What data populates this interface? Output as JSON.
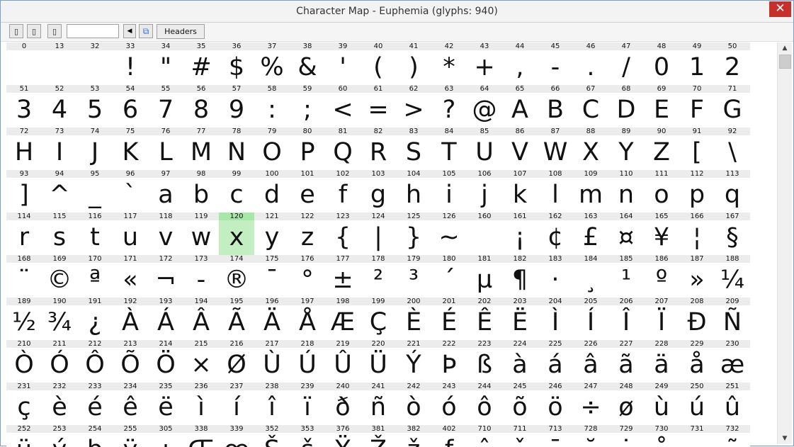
{
  "window": {
    "title": "Character Map - Euphemia   (glyphs: 940)",
    "close_label": "✕"
  },
  "toolbar": {
    "btn1": "▯",
    "btn2": "▯",
    "btn3": "▯",
    "search_value": "",
    "arrow_label": "◀",
    "copy_label": "⧉",
    "headers_label": "Headers"
  },
  "selected_code": "120",
  "glyph_rows": [
    [
      [
        "0",
        ""
      ],
      [
        "13",
        ""
      ],
      [
        "32",
        ""
      ],
      [
        "33",
        "!"
      ],
      [
        "34",
        "\""
      ],
      [
        "35",
        "#"
      ],
      [
        "36",
        "$"
      ],
      [
        "37",
        "%"
      ],
      [
        "38",
        "&"
      ],
      [
        "39",
        "'"
      ],
      [
        "40",
        "("
      ],
      [
        "41",
        ")"
      ],
      [
        "42",
        "*"
      ],
      [
        "43",
        "+"
      ],
      [
        "44",
        ","
      ],
      [
        "45",
        "-"
      ],
      [
        "46",
        "."
      ],
      [
        "47",
        "/"
      ],
      [
        "48",
        "0"
      ],
      [
        "49",
        "1"
      ],
      [
        "50",
        "2"
      ]
    ],
    [
      [
        "51",
        "3"
      ],
      [
        "52",
        "4"
      ],
      [
        "53",
        "5"
      ],
      [
        "54",
        "6"
      ],
      [
        "55",
        "7"
      ],
      [
        "56",
        "8"
      ],
      [
        "57",
        "9"
      ],
      [
        "58",
        ":"
      ],
      [
        "59",
        ";"
      ],
      [
        "60",
        "<"
      ],
      [
        "61",
        "="
      ],
      [
        "62",
        ">"
      ],
      [
        "63",
        "?"
      ],
      [
        "64",
        "@"
      ],
      [
        "65",
        "A"
      ],
      [
        "66",
        "B"
      ],
      [
        "67",
        "C"
      ],
      [
        "68",
        "D"
      ],
      [
        "69",
        "E"
      ],
      [
        "70",
        "F"
      ],
      [
        "71",
        "G"
      ]
    ],
    [
      [
        "72",
        "H"
      ],
      [
        "73",
        "I"
      ],
      [
        "74",
        "J"
      ],
      [
        "75",
        "K"
      ],
      [
        "76",
        "L"
      ],
      [
        "77",
        "M"
      ],
      [
        "78",
        "N"
      ],
      [
        "79",
        "O"
      ],
      [
        "80",
        "P"
      ],
      [
        "81",
        "Q"
      ],
      [
        "82",
        "R"
      ],
      [
        "83",
        "S"
      ],
      [
        "84",
        "T"
      ],
      [
        "85",
        "U"
      ],
      [
        "86",
        "V"
      ],
      [
        "87",
        "W"
      ],
      [
        "88",
        "X"
      ],
      [
        "89",
        "Y"
      ],
      [
        "90",
        "Z"
      ],
      [
        "91",
        "["
      ],
      [
        "92",
        "\\"
      ]
    ],
    [
      [
        "93",
        "]"
      ],
      [
        "94",
        "^"
      ],
      [
        "95",
        "_"
      ],
      [
        "96",
        "`"
      ],
      [
        "97",
        "a"
      ],
      [
        "98",
        "b"
      ],
      [
        "99",
        "c"
      ],
      [
        "100",
        "d"
      ],
      [
        "101",
        "e"
      ],
      [
        "102",
        "f"
      ],
      [
        "103",
        "g"
      ],
      [
        "104",
        "h"
      ],
      [
        "105",
        "i"
      ],
      [
        "106",
        "j"
      ],
      [
        "107",
        "k"
      ],
      [
        "108",
        "l"
      ],
      [
        "109",
        "m"
      ],
      [
        "110",
        "n"
      ],
      [
        "111",
        "o"
      ],
      [
        "112",
        "p"
      ],
      [
        "113",
        "q"
      ]
    ],
    [
      [
        "114",
        "r"
      ],
      [
        "115",
        "s"
      ],
      [
        "116",
        "t"
      ],
      [
        "117",
        "u"
      ],
      [
        "118",
        "v"
      ],
      [
        "119",
        "w"
      ],
      [
        "120",
        "x"
      ],
      [
        "121",
        "y"
      ],
      [
        "122",
        "z"
      ],
      [
        "123",
        "{"
      ],
      [
        "124",
        "|"
      ],
      [
        "125",
        "}"
      ],
      [
        "126",
        "~"
      ],
      [
        "160",
        ""
      ],
      [
        "161",
        "¡"
      ],
      [
        "162",
        "¢"
      ],
      [
        "163",
        "£"
      ],
      [
        "164",
        "¤"
      ],
      [
        "165",
        "¥"
      ],
      [
        "166",
        "¦"
      ],
      [
        "167",
        "§"
      ]
    ],
    [
      [
        "168",
        "¨"
      ],
      [
        "169",
        "©"
      ],
      [
        "170",
        "ª"
      ],
      [
        "171",
        "«"
      ],
      [
        "172",
        "¬"
      ],
      [
        "173",
        "-"
      ],
      [
        "174",
        "®"
      ],
      [
        "175",
        "¯"
      ],
      [
        "176",
        "°"
      ],
      [
        "177",
        "±"
      ],
      [
        "178",
        "²"
      ],
      [
        "179",
        "³"
      ],
      [
        "180",
        "´"
      ],
      [
        "181",
        "µ"
      ],
      [
        "182",
        "¶"
      ],
      [
        "183",
        "·"
      ],
      [
        "184",
        "¸"
      ],
      [
        "185",
        "¹"
      ],
      [
        "186",
        "º"
      ],
      [
        "187",
        "»"
      ],
      [
        "188",
        "¼"
      ]
    ],
    [
      [
        "189",
        "½"
      ],
      [
        "190",
        "¾"
      ],
      [
        "191",
        "¿"
      ],
      [
        "192",
        "À"
      ],
      [
        "193",
        "Á"
      ],
      [
        "194",
        "Â"
      ],
      [
        "195",
        "Ã"
      ],
      [
        "196",
        "Ä"
      ],
      [
        "197",
        "Å"
      ],
      [
        "198",
        "Æ"
      ],
      [
        "199",
        "Ç"
      ],
      [
        "200",
        "È"
      ],
      [
        "201",
        "É"
      ],
      [
        "202",
        "Ê"
      ],
      [
        "203",
        "Ë"
      ],
      [
        "204",
        "Ì"
      ],
      [
        "205",
        "Í"
      ],
      [
        "206",
        "Î"
      ],
      [
        "207",
        "Ï"
      ],
      [
        "208",
        "Ð"
      ],
      [
        "209",
        "Ñ"
      ]
    ],
    [
      [
        "210",
        "Ò"
      ],
      [
        "211",
        "Ó"
      ],
      [
        "212",
        "Ô"
      ],
      [
        "213",
        "Õ"
      ],
      [
        "214",
        "Ö"
      ],
      [
        "215",
        "×"
      ],
      [
        "216",
        "Ø"
      ],
      [
        "217",
        "Ù"
      ],
      [
        "218",
        "Ú"
      ],
      [
        "219",
        "Û"
      ],
      [
        "220",
        "Ü"
      ],
      [
        "221",
        "Ý"
      ],
      [
        "222",
        "Þ"
      ],
      [
        "223",
        "ß"
      ],
      [
        "224",
        "à"
      ],
      [
        "225",
        "á"
      ],
      [
        "226",
        "â"
      ],
      [
        "227",
        "ã"
      ],
      [
        "228",
        "ä"
      ],
      [
        "229",
        "å"
      ],
      [
        "230",
        "æ"
      ]
    ],
    [
      [
        "231",
        "ç"
      ],
      [
        "232",
        "è"
      ],
      [
        "233",
        "é"
      ],
      [
        "234",
        "ê"
      ],
      [
        "235",
        "ë"
      ],
      [
        "236",
        "ì"
      ],
      [
        "237",
        "í"
      ],
      [
        "238",
        "î"
      ],
      [
        "239",
        "ï"
      ],
      [
        "240",
        "ð"
      ],
      [
        "241",
        "ñ"
      ],
      [
        "242",
        "ò"
      ],
      [
        "243",
        "ó"
      ],
      [
        "244",
        "ô"
      ],
      [
        "245",
        "õ"
      ],
      [
        "246",
        "ö"
      ],
      [
        "247",
        "÷"
      ],
      [
        "248",
        "ø"
      ],
      [
        "249",
        "ù"
      ],
      [
        "250",
        "ú"
      ],
      [
        "251",
        "û"
      ]
    ],
    [
      [
        "252",
        "ü"
      ],
      [
        "253",
        "ý"
      ],
      [
        "254",
        "þ"
      ],
      [
        "255",
        "ÿ"
      ],
      [
        "305",
        "ı"
      ],
      [
        "338",
        "Œ"
      ],
      [
        "339",
        "œ"
      ],
      [
        "352",
        "Š"
      ],
      [
        "353",
        "š"
      ],
      [
        "376",
        "Ÿ"
      ],
      [
        "381",
        "Ž"
      ],
      [
        "382",
        "ž"
      ],
      [
        "402",
        "ƒ"
      ],
      [
        "710",
        "ˆ"
      ],
      [
        "711",
        "ˇ"
      ],
      [
        "713",
        "ˉ"
      ],
      [
        "728",
        "˘"
      ],
      [
        "729",
        "˙"
      ],
      [
        "730",
        "˚"
      ],
      [
        "731",
        "˛"
      ],
      [
        "732",
        "˜"
      ]
    ]
  ],
  "colors": {
    "selection": "#c2eec2",
    "close": "#c7302a",
    "code_bg": "#ececec"
  },
  "scrollbar": {
    "up_label": "▲",
    "down_label": "▼"
  }
}
